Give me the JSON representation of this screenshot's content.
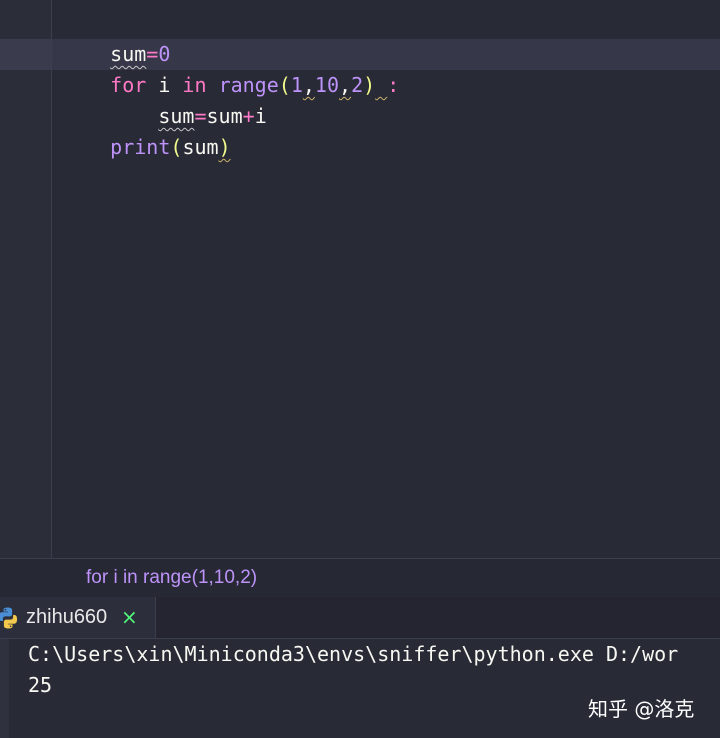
{
  "editor": {
    "code": {
      "l1_var": "sum",
      "l1_op": "=",
      "l1_num": "0",
      "l2_for": "for",
      "l2_i": " i ",
      "l2_in": "in",
      "l2_sp": " ",
      "l2_range": "range",
      "l2_open": "(",
      "l2_a": "1",
      "l2_c1": ",",
      "l2_b": "10",
      "l2_c2": ",",
      "l2_c": "2",
      "l2_close": ")",
      "l2_sp2": " ",
      "l2_colon": ":",
      "l3_indent": "    ",
      "l3_var": "sum",
      "l3_eq": "=",
      "l3_sum": "sum",
      "l3_plus": "+",
      "l3_i": "i",
      "l4_print": "print",
      "l4_open": "(",
      "l4_arg": "sum",
      "l4_close": ")"
    }
  },
  "breadcrumb": {
    "text": "for i in range(1,10,2)"
  },
  "run": {
    "tab_label": "zhihu660",
    "close_glyph": "×",
    "console_cmd": "C:\\Users\\xin\\Miniconda3\\envs\\sniffer\\python.exe D:/wor",
    "console_out": "25"
  },
  "watermark": "知乎 @洛克",
  "icons": {
    "run_tab": "python-icon"
  },
  "colors": {
    "background": "#282a36",
    "keyword": "#ff79c6",
    "number": "#bd93f9",
    "paren": "#f1fa8c",
    "breadcrumb": "#bd93f9",
    "close": "#50fa7b"
  }
}
